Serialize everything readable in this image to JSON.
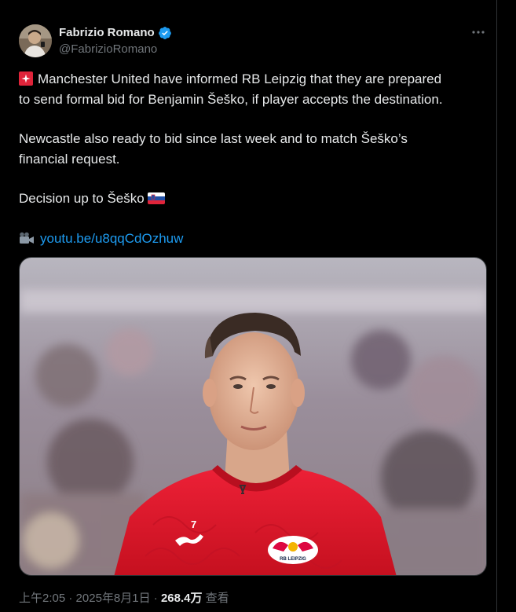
{
  "author": {
    "display_name": "Fabrizio Romano",
    "handle": "@FabrizioRomano",
    "verified": true,
    "avatar_icon": "profile-avatar"
  },
  "menu": {
    "icon": "more-dots-icon"
  },
  "tweet": {
    "para1_line1": "Manchester United have informed RB Leipzig that they are prepared",
    "para1_line2": "to send formal bid for Benjamin Šeško, if player accepts the destination.",
    "para2_line1": "Newcastle also ready to bid since last week and to match Šeško’s",
    "para2_line2": "financial request.",
    "para3": "Decision up to Šeško",
    "link_text": "youtu.be/u8qqCdOzhuw",
    "emoji_siren": "siren-icon",
    "emoji_flag": "slovenia-flag-icon",
    "emoji_camera": "video-camera-icon"
  },
  "media": {
    "jersey_number": "7",
    "badge_text": "RB LEIPZIG"
  },
  "meta": {
    "time": "上午2:05",
    "separator1": " · ",
    "date": "2025年8月1日",
    "separator2": " · ",
    "views_count": "268.4万",
    "views_label": " 查看"
  },
  "colors": {
    "background": "#000000",
    "text_primary": "#e7e9ea",
    "text_secondary": "#71767b",
    "link": "#1d9bf0",
    "verified": "#1d9bf0",
    "jersey_red": "#e3162d"
  }
}
